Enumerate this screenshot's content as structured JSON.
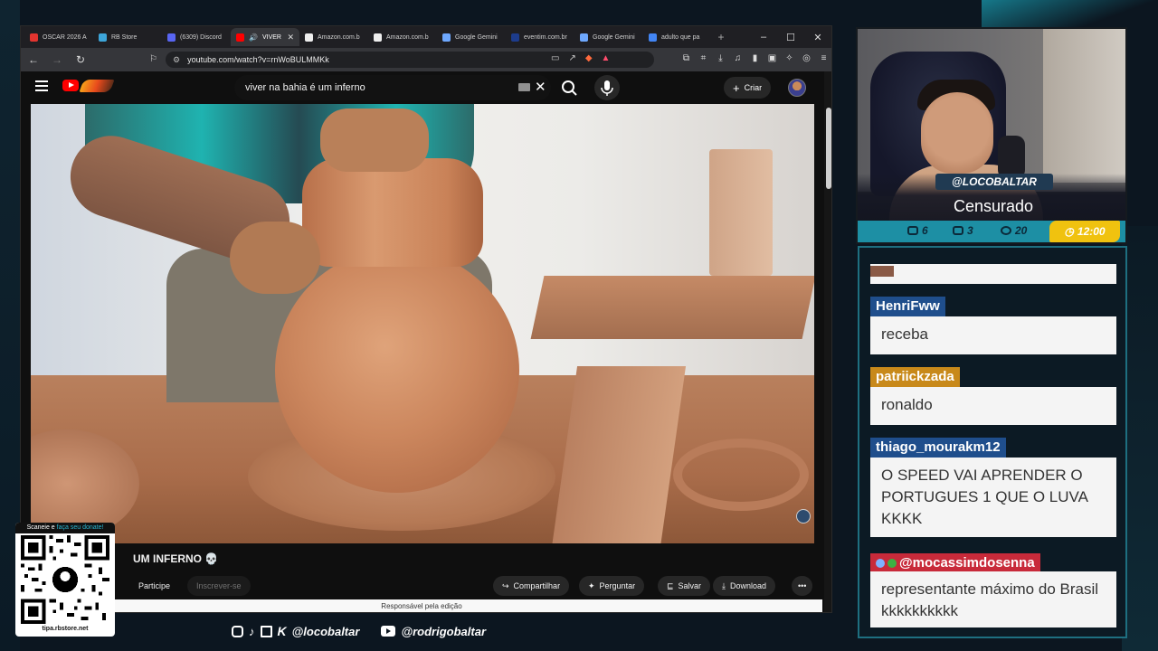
{
  "browser": {
    "tabs": [
      {
        "label": "OSCAR 2026 A",
        "color": "#e3342f"
      },
      {
        "label": "RB Store",
        "color": "#3da5d9"
      },
      {
        "label": "(6309) Discord",
        "color": "#5865f2"
      },
      {
        "label": "VIVER",
        "color": "#ff0000",
        "active": true
      },
      {
        "label": "Amazon.com.b",
        "color": "#eeeeee"
      },
      {
        "label": "Amazon.com.b",
        "color": "#eeeeee"
      },
      {
        "label": "Google Gemini",
        "color": "#6ea8fe"
      },
      {
        "label": "eventim.com.br",
        "color": "#1d3c8c"
      },
      {
        "label": "Google Gemini",
        "color": "#6ea8fe"
      },
      {
        "label": "adulto que pa",
        "color": "#4285f4"
      }
    ],
    "url": "youtube.com/watch?v=rnWoBULMMKk"
  },
  "youtube": {
    "search_value": "viver na bahia é um inferno",
    "create_label": "Criar",
    "video_title": "UM INFERNO",
    "join_label": "Participe",
    "subscribe_label": "Inscrever-se",
    "share_label": "Compartilhar",
    "ask_label": "Perguntar",
    "save_label": "Salvar",
    "download_label": "Download",
    "editor_notice": "Responsável pela edição"
  },
  "stream": {
    "handle": "@LOCOBALTAR",
    "title": "Censurado",
    "stats": {
      "chat": "6",
      "youtube": "3",
      "discord": "20",
      "time": "12:00"
    },
    "accent": "#1d8fa4",
    "gold": "#f0c20f"
  },
  "chat": {
    "messages": [
      {
        "user": "HenriFww",
        "text": "receba",
        "color": "#1f4e8c"
      },
      {
        "user": "patriickzada",
        "text": "ronaldo",
        "color": "#c8891a"
      },
      {
        "user": "thiago_mourakm12",
        "text": "O SPEED VAI APRENDER O PORTUGUES 1 QUE O LUVA KKKK",
        "color": "#1f4e8c"
      },
      {
        "user": "@mocassimdosenna",
        "text": "representante máximo do Brasil kkkkkkkkkk",
        "color": "#c82a3a"
      }
    ]
  },
  "qr": {
    "header_prefix": "Scaneie e",
    "header_highlight": "faça seu donate!",
    "footer": "tipa.rbstore.net"
  },
  "socials": {
    "handle_primary": "@locobaltar",
    "handle_youtube": "@rodrigobaltar"
  }
}
